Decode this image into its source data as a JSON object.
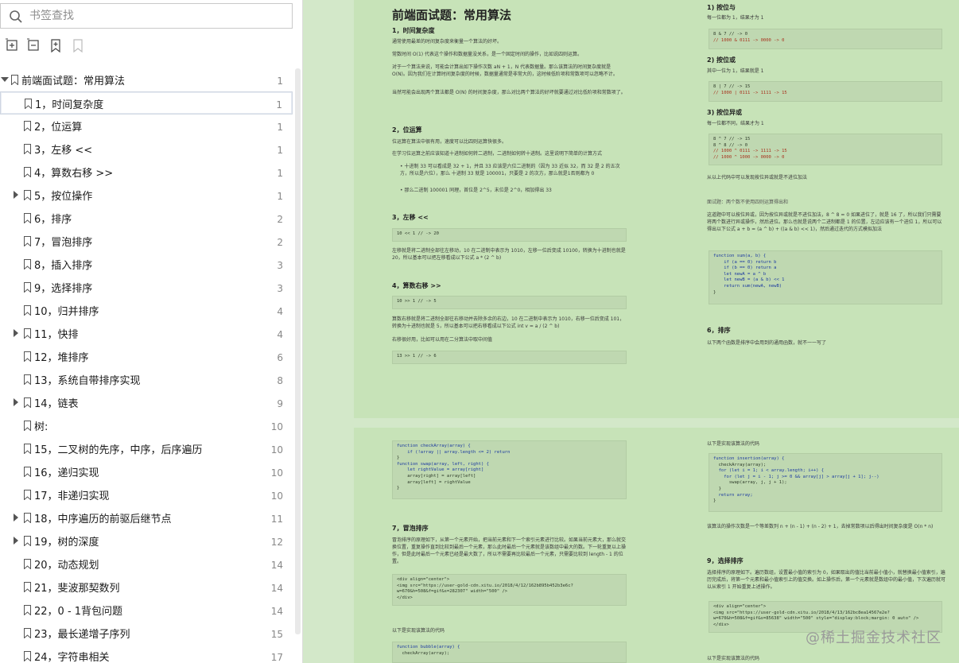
{
  "search": {
    "placeholder": "书签查找"
  },
  "tree": [
    {
      "label": "前端面试题：常用算法",
      "page": "1",
      "expandable": true,
      "expanded": true,
      "level": 0
    },
    {
      "label": "1，时间复杂度",
      "page": "1",
      "level": 1,
      "selected": true
    },
    {
      "label": "2，位运算",
      "page": "1",
      "level": 1
    },
    {
      "label": "3，左移 <<",
      "page": "1",
      "level": 1
    },
    {
      "label": "4，算数右移 >>",
      "page": "1",
      "level": 1
    },
    {
      "label": "5，按位操作",
      "page": "1",
      "level": 1,
      "expandable": true
    },
    {
      "label": "6，排序",
      "page": "2",
      "level": 1
    },
    {
      "label": "7，冒泡排序",
      "page": "2",
      "level": 1
    },
    {
      "label": "8，插入排序",
      "page": "3",
      "level": 1
    },
    {
      "label": "9，选择排序",
      "page": "3",
      "level": 1
    },
    {
      "label": "10，归并排序",
      "page": "4",
      "level": 1
    },
    {
      "label": "11，快排",
      "page": "4",
      "level": 1,
      "expandable": true
    },
    {
      "label": "12，堆排序",
      "page": "6",
      "level": 1
    },
    {
      "label": "13，系统自带排序实现",
      "page": "8",
      "level": 1
    },
    {
      "label": "14，链表",
      "page": "9",
      "level": 1,
      "expandable": true
    },
    {
      "label": "树:",
      "page": "10",
      "level": 1
    },
    {
      "label": "15，二叉树的先序，中序，后序遍历",
      "page": "10",
      "level": 1
    },
    {
      "label": "16，递归实现",
      "page": "10",
      "level": 1
    },
    {
      "label": "17，非递归实现",
      "page": "10",
      "level": 1
    },
    {
      "label": "18，中序遍历的前驱后继节点",
      "page": "11",
      "level": 1,
      "expandable": true
    },
    {
      "label": "19，树的深度",
      "page": "12",
      "level": 1,
      "expandable": true
    },
    {
      "label": "20，动态规划",
      "page": "14",
      "level": 1
    },
    {
      "label": "21，斐波那契数列",
      "page": "14",
      "level": 1
    },
    {
      "label": "22，0 - 1背包问题",
      "page": "14",
      "level": 1
    },
    {
      "label": "23，最长递增子序列",
      "page": "15",
      "level": 1
    },
    {
      "label": "24，字符串相关",
      "page": "17",
      "level": 1
    }
  ],
  "doc": {
    "title": "前端面试题：常用算法",
    "s1_title": "1，时间复杂度",
    "s1_p1": "通常使用最差的时间复杂度来衡量一个算法的好坏。",
    "s1_p2": "常数时间 O(1) 代表这个操作和数据量没关系，是一个固定时间的操作，比如说四则运算。",
    "s1_p3": "对于一个算法来说，可能会计算出如下操作次数 aN + 1，N 代表数据量。那么该算法的时间复杂度就是 O(N)。因为我们在计算时间复杂度的时候，数据量通常是非常大的，这时候低阶项和常数项可以忽略不计。",
    "s1_p4": "当然可能会出现两个算法都是 O(N) 的时间复杂度，那么对比两个算法的好坏就要通过对比低阶项和常数项了。",
    "s2_title": "2，位运算",
    "s2_p1": "位运算在算法中很有用，速度可以比四则运算快很多。",
    "s2_p2": "在学习位运算之前应该知道十进制如何转二进制，二进制如何转十进制。这里说明下简单的计算方式",
    "s2_b1": "十进制 33 可以看成是 32 + 1，并且 33 应该是六位二进制的（因为 33 近似 32，而 32 是 2 的五次方，所以是六位），那么 十进制 33 就是 100001，只要是 2 的次方，那么就是1否则都为 0",
    "s2_b2": "那么二进制 100001 同理，首位是 2^5，末位是 2^0，相加得出 33",
    "s3_title": "3，左移 <<",
    "s3_code": "10 << 1 // -> 20",
    "s3_p1": "左移就是将二进制全部往左移动，10 在二进制中表示为 1010，左移一位后变成 10100，转换为十进制也就是 20，所以基本可以把左移看成以下公式 a * (2 ^ b)",
    "s4_title": "4，算数右移 >>",
    "s4_code": "10 >> 1 // -> 5",
    "s4_p1": "算数右移就是将二进制全部往右移动并去除多余的右边，10 在二进制中表示为 1010，右移一位后变成 101，转换为十进制也就是 5，所以基本可以把右移看成以下公式 int v = a / (2 ^ b)",
    "s4_p2": "右移很好用，比如可以用在二分算法中取中间值",
    "s4_code2": "13 >> 1 // -> 6",
    "r1_title": "1) 按位与",
    "r1_p": "每一位都为 1，结果才为 1",
    "r1_code1": "8 & 7 // -> 0",
    "r1_code2": "// 1000 & 0111 -> 0000 -> 0",
    "r2_title": "2) 按位或",
    "r2_p": "其中一位为 1，结果就是 1",
    "r2_code1": "8 | 7 // -> 15",
    "r2_code2": "// 1000 | 0111 -> 1111 -> 15",
    "r3_title": "3) 按位异或",
    "r3_p": "每一位都不同，结果才为 1",
    "r3_code1": "8 ^ 7 // -> 15",
    "r3_code2": "8 ^ 8 // -> 0",
    "r3_code3": "// 1000 ^ 0111 -> 1111 -> 15",
    "r3_code4": "// 1000 ^ 1000 -> 0000 -> 0",
    "r3_after": "从以上代码中可以发现按位异或就是不进位加法",
    "r_q": "面试题：两个数不使用四则运算得出和",
    "r_qp": "这道题中可以按位异或，因为按位异或就是不进位加法，8 ^ 8 = 0 如果进位了，就是 16 了，所以我们只需要将两个数进行异或操作，然后进位。那么也就是说两个二进制都是 1 的位置，左边应该有一个进位 1，所以可以得出以下公式 a + b = (a ^ b) + ((a & b) << 1)，然后通过迭代的方式模拟加法",
    "sum_code": [
      "function sum(a, b) {",
      "    if (a == 0) return b",
      "    if (b == 0) return a",
      "    let newA = a ^ b",
      "    let newB = (a & b) << 1",
      "    return sum(newA, newB)",
      "}"
    ],
    "s6_title": "6，排序",
    "s6_p": "以下两个函数是排序中会用到的通用函数，就不一一写了",
    "check_code": [
      "function checkArray(array) {",
      "    if (!array || array.length <= 2) return",
      "}",
      "function swap(array, left, right) {",
      "    let rightValue = array[right]",
      "    array[right] = array[left]",
      "    array[left] = rightValue",
      "}"
    ],
    "s7_title": "7，冒泡排序",
    "s7_p": "冒泡排序的原理如下，从第一个元素开始，把当前元素和下一个索引元素进行比较。如果当前元素大，那么就交换位置，重复操作直到比较到最后一个元素，那么此时最后一个元素就是该数组中最大的数。下一轮重复以上操作，但是此时最后一个元素已经是最大数了，所以不需要再比较最后一个元素，只需要比较到 length - 1 的位置。",
    "img_code": [
      "<div align=\"center\">",
      "<img src=\"https://user-gold-cdn.xitu.io/2018/4/12/162b895b452b3e6c?",
      "w=670&h=508&f=gif&s=282307\" width=\"500\" />",
      "</div>"
    ],
    "s7_after": "以下是实现该算法的代码",
    "bubble_code": [
      "function bubble(array) {",
      "  checkArray(array);"
    ],
    "s8_pre": "以下是实现该算法的代码",
    "insert_code": [
      "function insertion(array) {",
      "  checkArray(array);",
      "  for (let i = 1; i < array.length; i++) {",
      "    for (let j = i - 1; j >= 0 && array[j] > array[j + 1]; j--)",
      "      swap(array, j, j + 1);",
      "  }",
      "  return array;",
      "}"
    ],
    "s8_after": "该算法的操作次数是一个等差数列 n + (n - 1) + (n - 2) + 1，去掉常数项以后得出时间复杂度是 O(n * n)",
    "s9_title": "9，选择排序",
    "s9_p": "选择排序的原理如下。遍历数组，设置最小值的索引为 0，如果取出的值比当前最小值小，就替换最小值索引，遍历完成后，将第一个元素和最小值索引上的值交换。如上操作后，第一个元素就是数组中的最小值，下次遍历就可以从索引 1 开始重复上述操作。",
    "img2_code": [
      "<div align=\"center\">",
      "<img src=\"https://user-gold-cdn.xitu.io/2018/4/13/162bc8ea14567e2e?",
      "w=670&h=508&f=gif&s=85638\" width=\"500\" style=\"display:block;margin: 0 auto\" />",
      "</div>"
    ],
    "s9_after": "以下是实现该算法的代码"
  },
  "watermark": "@稀土掘金技术社区"
}
